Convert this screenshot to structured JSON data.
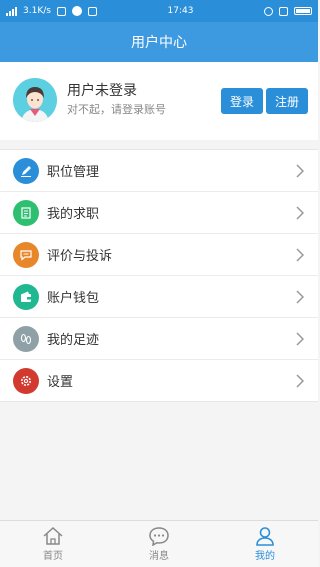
{
  "status_bar": {
    "carrier": "3.1K/s",
    "time": "17:43"
  },
  "header": {
    "title": "用户中心"
  },
  "profile": {
    "name": "用户未登录",
    "subtitle": "对不起，请登录账号",
    "login_label": "登录",
    "register_label": "注册"
  },
  "menu": [
    {
      "label": "职位管理",
      "icon": "edit-icon",
      "color": "#2a8fd8"
    },
    {
      "label": "我的求职",
      "icon": "clipboard-icon",
      "color": "#2fbf71"
    },
    {
      "label": "评价与投诉",
      "icon": "chat-icon",
      "color": "#e8862a"
    },
    {
      "label": "账户钱包",
      "icon": "wallet-icon",
      "color": "#1fb890"
    },
    {
      "label": "我的足迹",
      "icon": "footprint-icon",
      "color": "#8fa1a6"
    },
    {
      "label": "设置",
      "icon": "gear-icon",
      "color": "#d33a2f"
    }
  ],
  "tabs": [
    {
      "label": "首页",
      "icon": "home-icon",
      "active": false
    },
    {
      "label": "消息",
      "icon": "message-icon",
      "active": false
    },
    {
      "label": "我的",
      "icon": "user-icon",
      "active": true
    }
  ],
  "colors": {
    "brand": "#2a8fd8",
    "header": "#3d9ae0"
  }
}
